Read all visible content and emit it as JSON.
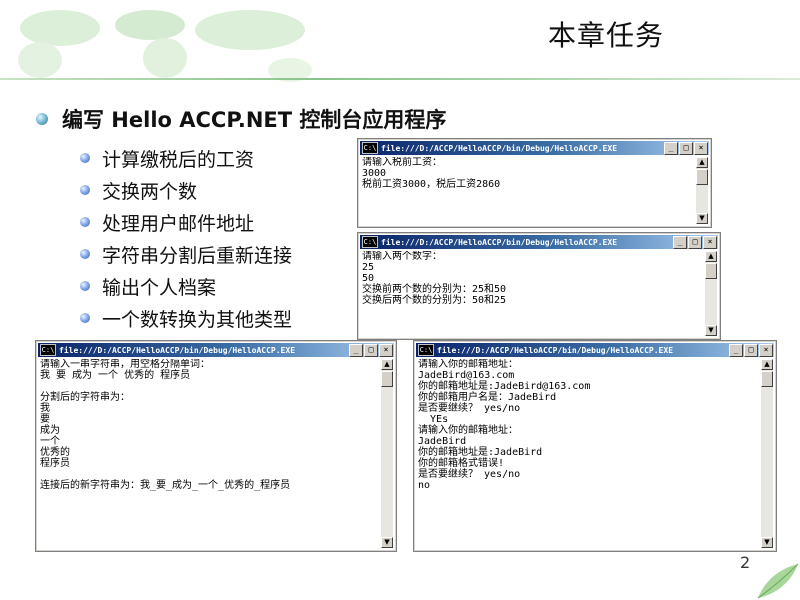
{
  "slide": {
    "title": "本章任务",
    "main_bullet": "编写 Hello ACCP.NET 控制台应用程序",
    "sub_bullets": [
      "计算缴税后的工资",
      "交换两个数",
      "处理用户邮件地址",
      "字符串分割后重新连接",
      "输出个人档案",
      "一个数转换为其他类型"
    ],
    "page_number": "2"
  },
  "consoles": [
    {
      "title": "file:///D:/ACCP/HelloACCP/bin/Debug/HelloACCP.EXE",
      "icon": "C:\\",
      "lines": "请输入税前工资：\n3000\n税前工资3000，税后工资2860"
    },
    {
      "title": "file:///D:/ACCP/HelloACCP/bin/Debug/HelloACCP.EXE",
      "icon": "C:\\",
      "lines": "请输入两个数字：\n25\n50\n交换前两个数的分别为：25和50\n交换后两个数的分别为：50和25"
    },
    {
      "title": "file:///D:/ACCP/HelloACCP/bin/Debug/HelloACCP.EXE",
      "icon": "C:\\",
      "lines": "请输入一串字符串，用空格分隔单词：\n我 要 成为 一个 优秀的 程序员\n\n分割后的字符串为：\n我\n要\n成为\n一个\n优秀的\n程序员\n\n连接后的新字符串为：我_要_成为_一个_优秀的_程序员"
    },
    {
      "title": "file:///D:/ACCP/HelloACCP/bin/Debug/HelloACCP.EXE",
      "icon": "C:\\",
      "lines": "请输入你的邮箱地址：\nJadeBird@163.com\n你的邮箱地址是:JadeBird@163.com\n你的邮箱用户名是：JadeBird\n是否要继续？ yes/no\n  YEs\n请输入你的邮箱地址：\nJadeBird\n你的邮箱地址是:JadeBird\n你的邮箱格式错误!\n是否要继续？ yes/no\nno"
    }
  ],
  "window_buttons": {
    "minimize": "_",
    "maximize": "□",
    "close": "×"
  },
  "scroll_buttons": {
    "up": "▲",
    "down": "▼"
  }
}
